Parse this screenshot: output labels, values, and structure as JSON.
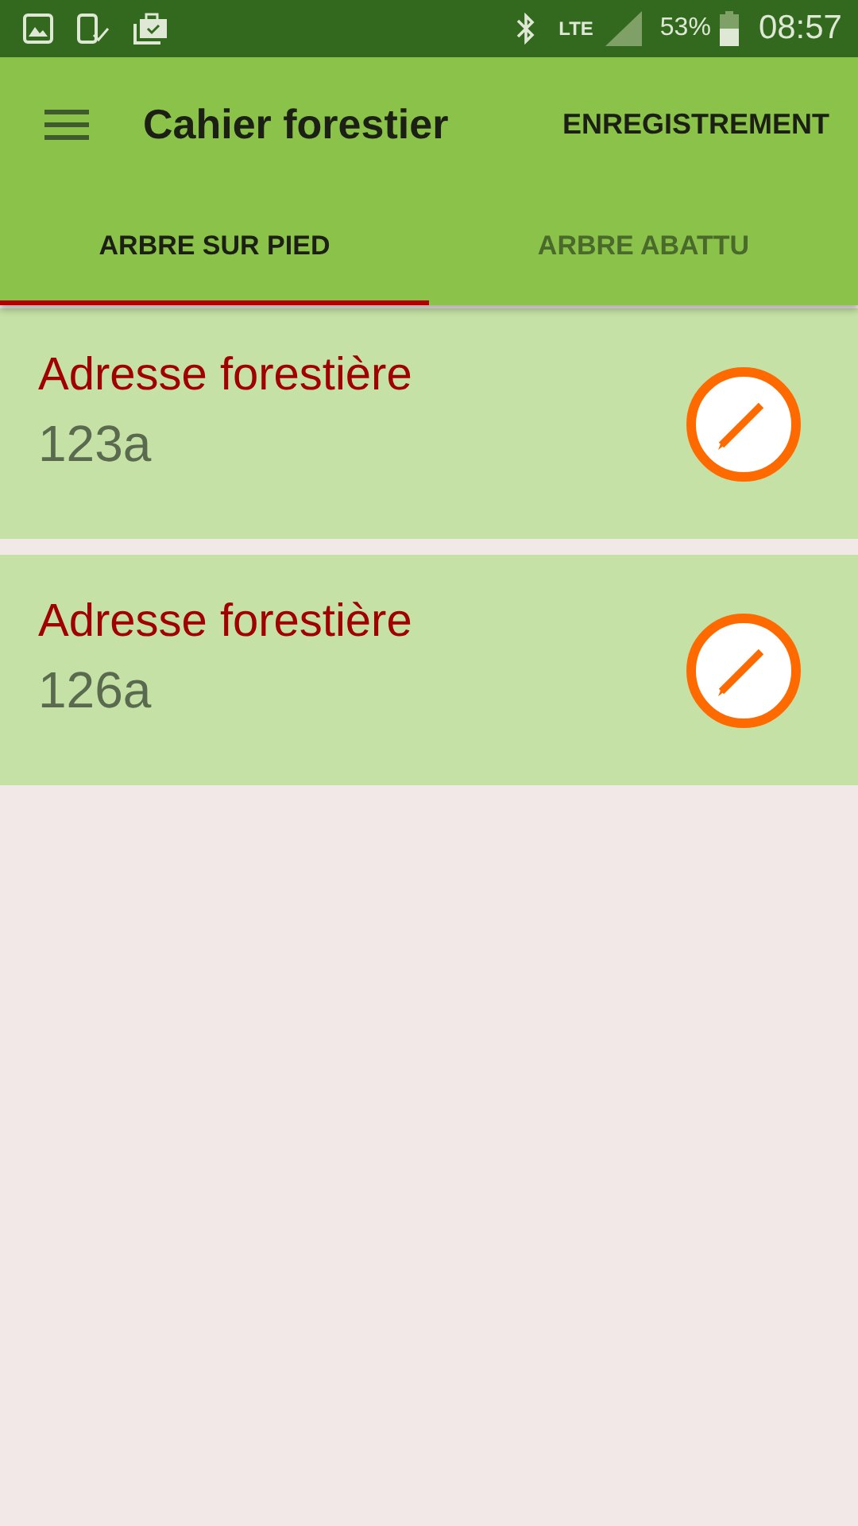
{
  "status_bar": {
    "network": "LTE",
    "battery": "53%",
    "time": "08:57"
  },
  "toolbar": {
    "title": "Cahier forestier",
    "action": "ENREGISTREMENT"
  },
  "tabs": [
    {
      "label": "ARBRE SUR PIED",
      "selected": true
    },
    {
      "label": "ARBRE ABATTU",
      "selected": false
    }
  ],
  "items": [
    {
      "title": "Adresse forestière",
      "subtitle": "123a"
    },
    {
      "title": "Adresse forestière",
      "subtitle": "126a"
    }
  ]
}
